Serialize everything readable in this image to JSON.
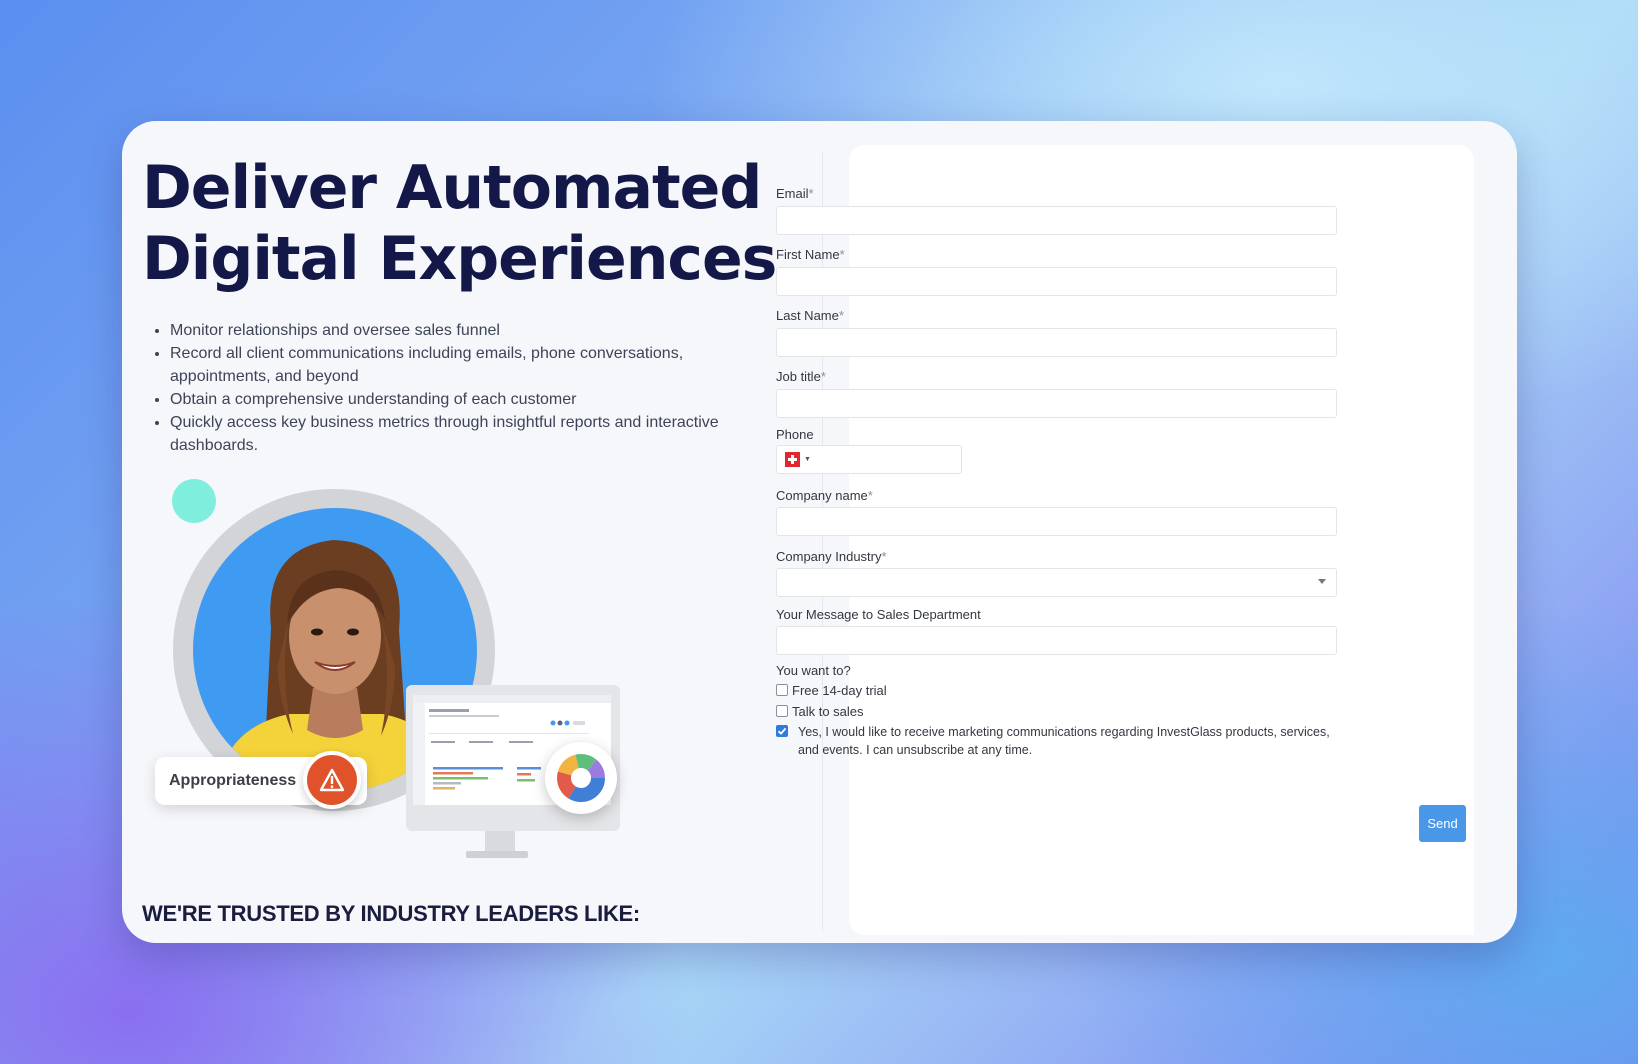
{
  "hero": {
    "headline": "Deliver Automated Digital Experiences",
    "features": [
      "Monitor relationships and oversee sales funnel",
      "Record all client communications including emails, phone conversations, appointments, and beyond",
      "Obtain a comprehensive understanding of each customer",
      "Quickly access key business metrics through insightful reports and interactive dashboards."
    ],
    "badge_label": "Appropriateness",
    "trusted_heading": "WE'RE TRUSTED BY INDUSTRY LEADERS LIKE:"
  },
  "form": {
    "required_mark": "*",
    "fields": {
      "email": {
        "label": "Email",
        "value": ""
      },
      "first_name": {
        "label": "First Name",
        "value": ""
      },
      "last_name": {
        "label": "Last Name",
        "value": ""
      },
      "job_title": {
        "label": "Job title",
        "value": ""
      },
      "phone": {
        "label": "Phone",
        "value": "",
        "country": "Switzerland"
      },
      "company_name": {
        "label": "Company name",
        "value": ""
      },
      "company_industry": {
        "label": "Company Industry",
        "value": ""
      },
      "message": {
        "label": "Your Message to Sales Department",
        "value": ""
      }
    },
    "question": "You want to?",
    "options": {
      "trial": {
        "label": "Free 14-day trial",
        "checked": false
      },
      "talk": {
        "label": "Talk to sales",
        "checked": false
      },
      "marketing": {
        "label": "Yes, I would like to receive marketing communications regarding InvestGlass products, services, and events. I can unsubscribe at any time.",
        "checked": true
      }
    },
    "submit_label": "Send"
  },
  "colors": {
    "headline": "#131848",
    "accent_button": "#4a97e8",
    "alert_badge": "#e0532a",
    "portrait_bg": "#3f9bf2",
    "teal_dot": "#7feedd"
  },
  "icons": {
    "alert": "warning-triangle-icon",
    "flag": "swiss-flag-icon",
    "dropdown": "chevron-down-icon"
  }
}
